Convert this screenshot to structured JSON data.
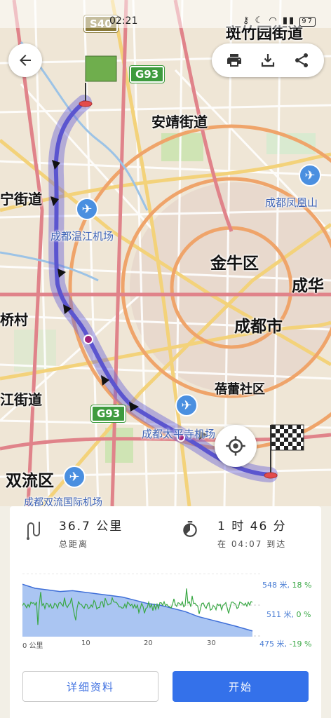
{
  "status": {
    "time": "02:21",
    "battery": "97"
  },
  "map": {
    "road_shields": [
      "S40",
      "G93",
      "G93"
    ],
    "labels": {
      "banzhuyuan": "斑竹园街道",
      "anjing": "安靖街道",
      "ningjiedao": "宁街道",
      "wenjiang_airport": "成都温江机场",
      "fenghuangshan": "成都凤凰山",
      "jinniu": "金牛区",
      "chenghua": "成华",
      "qiaocun": "桥村",
      "chengdushi": "成都市",
      "beilei": "蓓蕾社区",
      "jiangjiedao": "江街道",
      "taipingsi": "成都太平寺机场",
      "shuangliu": "双流区",
      "shuangliu_airport": "成都双流国际机场"
    }
  },
  "summary": {
    "distance_value": "36.7 公里",
    "distance_label": "总距离",
    "duration_value": "1 时 46 分",
    "arrival_label": "在 04:07 到达"
  },
  "chart_data": {
    "type": "area",
    "title": "",
    "xlabel": "公里",
    "ylabel": "",
    "x_ticks": [
      "0 公里",
      "10",
      "20",
      "30"
    ],
    "xlim": [
      0,
      36.7
    ],
    "ylim": [
      475,
      548
    ],
    "elevation": {
      "x": [
        0,
        2,
        4,
        6,
        8,
        10,
        12,
        14,
        16,
        18,
        20,
        22,
        24,
        26,
        28,
        30,
        32,
        34,
        36.7
      ],
      "y": [
        540,
        535,
        533,
        531,
        532,
        530,
        528,
        526,
        524,
        520,
        516,
        514,
        510,
        506,
        500,
        496,
        492,
        488,
        482
      ]
    },
    "slope_range": [
      "18 %",
      "0 %",
      "-19 %"
    ],
    "legend_entries": [
      {
        "elevation": "548 米",
        "slope": "18 %"
      },
      {
        "elevation": "511 米",
        "slope": "0 %"
      },
      {
        "elevation": "475 米",
        "slope": "-19 %"
      }
    ]
  },
  "buttons": {
    "details": "详细资料",
    "start": "开始"
  },
  "colors": {
    "accent": "#3471ea",
    "route": "#6a64d8",
    "elevation_fill": "#aac5f2",
    "slope_line": "#3aa845"
  }
}
